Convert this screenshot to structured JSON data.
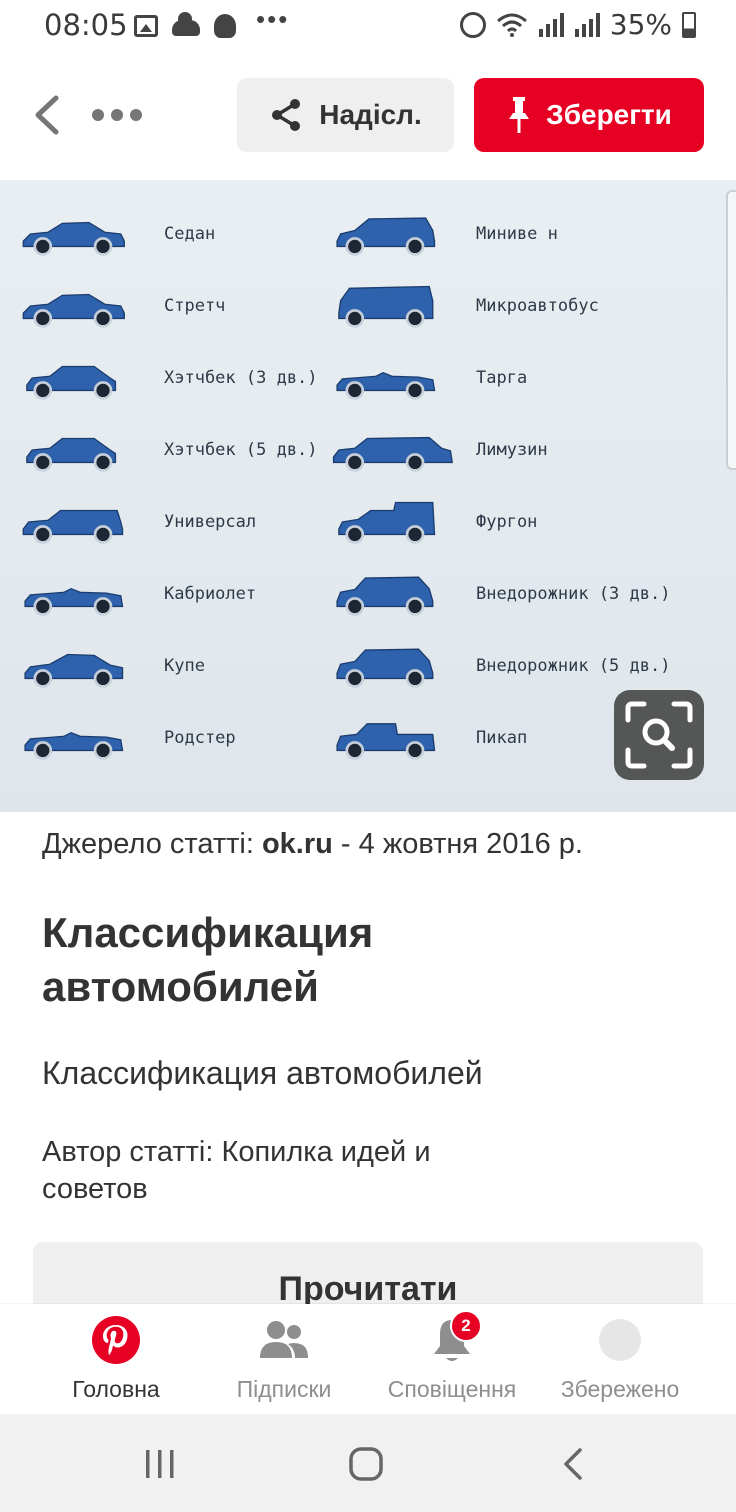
{
  "status_bar": {
    "time": "08:05",
    "battery_text": "35%",
    "icons_left": [
      "gallery-icon",
      "cloud-icon",
      "app-notification-icon",
      "more-notifications-icon"
    ],
    "icons_right": [
      "alarm-icon",
      "wifi-icon",
      "signal-icon",
      "signal-icon",
      "battery-icon"
    ]
  },
  "toolbar": {
    "back_icon": "chevron-left-icon",
    "more_icon": "more-horizontal-icon",
    "share_label": "Надісл.",
    "share_icon": "share-icon",
    "save_label": "Зберегти",
    "save_icon": "pin-icon"
  },
  "colors": {
    "brand_red": "#e60023",
    "button_gray": "#efefef",
    "car_blue": "#2e62ad",
    "text_dark": "#333333",
    "text_muted": "#8e8e8e"
  },
  "pin_image": {
    "left_column": [
      {
        "label": "Седан",
        "shape": "sedan"
      },
      {
        "label": "Стретч",
        "shape": "sedan"
      },
      {
        "label": "Хэтчбек (3 дв.)",
        "shape": "hatch"
      },
      {
        "label": "Хэтчбек (5 дв.)",
        "shape": "hatch"
      },
      {
        "label": "Универсал",
        "shape": "wagon"
      },
      {
        "label": "Кабриолет",
        "shape": "convertible"
      },
      {
        "label": "Купе",
        "shape": "coupe"
      },
      {
        "label": "Родстер",
        "shape": "convertible"
      }
    ],
    "right_column": [
      {
        "label": "Миниве н",
        "shape": "minivan"
      },
      {
        "label": "Микроавтобус",
        "shape": "van"
      },
      {
        "label": "Тарга",
        "shape": "convertible"
      },
      {
        "label": "Лимузин",
        "shape": "limo"
      },
      {
        "label": "Фургон",
        "shape": "panelvan"
      },
      {
        "label": "Внедорожник (3 дв.)",
        "shape": "suv"
      },
      {
        "label": "Внедорожник (5 дв.)",
        "shape": "suv"
      },
      {
        "label": "Пикап",
        "shape": "pickup"
      }
    ],
    "lens_icon": "visual-search-icon"
  },
  "article": {
    "source_prefix": "Джерело статті: ",
    "source_site": "ok.ru",
    "source_date": " - 4 жовтня 2016 р.",
    "title": "Классификация автомобилей",
    "description": "Классификация автомобилей",
    "author": "Автор статті: Копилка идей и советов",
    "read_button": "Прочитати"
  },
  "bottom_nav": {
    "items": [
      {
        "label": "Головна",
        "icon": "pinterest-logo-icon",
        "active": true
      },
      {
        "label": "Підписки",
        "icon": "people-icon",
        "active": false
      },
      {
        "label": "Сповіщення",
        "icon": "bell-icon",
        "active": false,
        "badge": "2"
      },
      {
        "label": "Збережено",
        "icon": "avatar-icon",
        "active": false
      }
    ]
  },
  "system_nav": {
    "icons": [
      "recent-apps-icon",
      "home-icon",
      "back-icon"
    ]
  }
}
